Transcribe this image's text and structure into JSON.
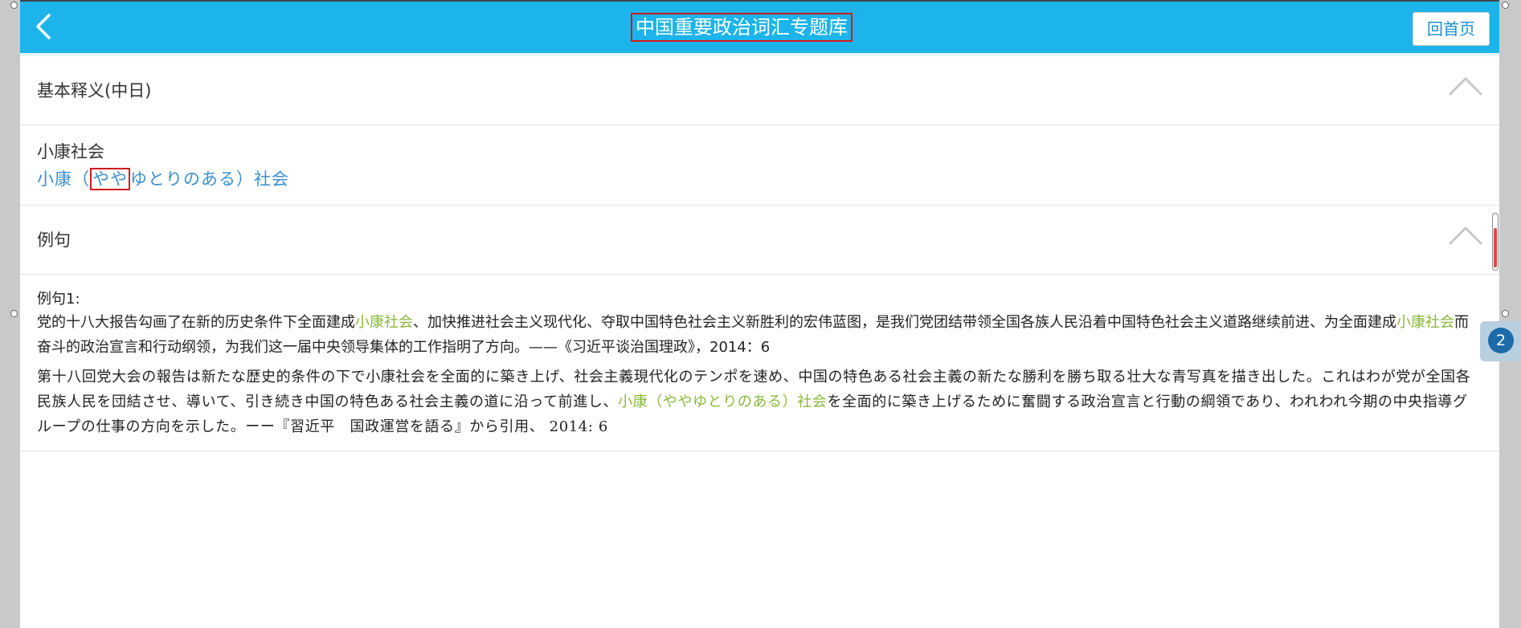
{
  "header": {
    "title": "中国重要政治词汇专题库",
    "home_label": "回首页"
  },
  "definition_section": {
    "label": "基本释义(中日)",
    "term_zh": "小康社会",
    "term_ja_before": "小康（",
    "term_ja_marked": "やや",
    "term_ja_after": "ゆとりのある）社会"
  },
  "example_section": {
    "label": "例句",
    "example_label": "例句1:",
    "zh": {
      "p1": "党的十八大报告勾画了在新的历史条件下全面建成",
      "hl1": "小康社会",
      "p2": "、加快推进社会主义现代化、夺取中国特色社会主义新胜利的宏伟蓝图，是我们党团结带领全国各族人民沿着中国特色社会主义道路继续前进、为全面建成",
      "hl2": "小康社会",
      "p3": "而奋斗的政治宣言和行动纲领，为我们这一届中央领导集体的工作指明了方向。——《习近平谈治国理政》，2014：6"
    },
    "ja": {
      "p1": "第十八回党大会の報告は新たな歴史的条件の下で小康社会を全面的に築き上げ、社会主義現代化のテンポを速め、中国の特色ある社会主義の新たな勝利を勝ち取る壮大な青写真を描き出した。これはわが党が全国各民族人民を団結させ、導いて、引き続き中国の特色ある社会主義の道に沿って前進し、",
      "hl": "小康（ややゆとりのある）社会",
      "p2": "を全面的に築き上げるために奮闘する政治宣言と行動の綱領であり、われわれ今期の中央指導グループの仕事の方向を示した。ーー『習近平　国政運営を語る』から引用、 2014: 6"
    }
  },
  "badge": {
    "count": "2"
  },
  "colors": {
    "header_bg": "#1cb4ea",
    "highlight_green": "#8ab83a",
    "term_blue": "#3a8fd1",
    "marker_red": "#d11c1c"
  },
  "icons": {
    "back": "chevron-left-icon",
    "collapse": "chevron-up-icon"
  }
}
